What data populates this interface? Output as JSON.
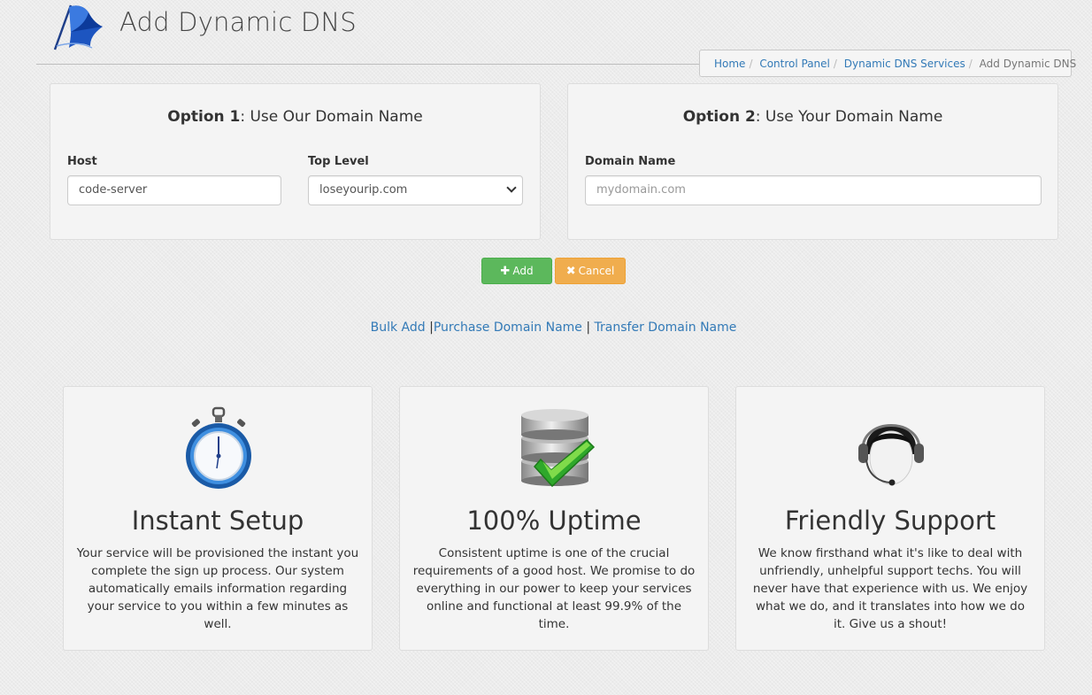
{
  "header": {
    "title": "Add Dynamic DNS",
    "logo_icon": "blue-flag-logo"
  },
  "breadcrumb": [
    {
      "label": "Home",
      "link": true
    },
    {
      "label": "Control Panel",
      "link": true
    },
    {
      "label": "Dynamic DNS Services",
      "link": true
    },
    {
      "label": "Add Dynamic DNS",
      "link": false
    }
  ],
  "option1": {
    "title_bold": "Option 1",
    "title_rest": ": Use Our Domain Name",
    "host_label": "Host",
    "host_value": "code-server",
    "toplevel_label": "Top Level",
    "toplevel_value": "loseyourip.com"
  },
  "option2": {
    "title_bold": "Option 2",
    "title_rest": ": Use Your Domain Name",
    "domain_label": "Domain Name",
    "domain_placeholder": "mydomain.com"
  },
  "actions": {
    "add_label": "Add",
    "add_icon": "plus-icon",
    "cancel_label": "Cancel",
    "cancel_icon": "x-icon",
    "add_color": "#5cb85c",
    "cancel_color": "#f0ad4e"
  },
  "links": {
    "bulk_add": "Bulk Add",
    "purchase": "Purchase Domain Name",
    "transfer": "Transfer Domain Name",
    "separator": "|"
  },
  "features": [
    {
      "icon": "stopwatch-icon",
      "title": "Instant Setup",
      "text": "Your service will be provisioned the instant you complete the sign up process. Our system automatically emails information regarding your service to you within a few minutes as well."
    },
    {
      "icon": "database-check-icon",
      "title": "100% Uptime",
      "text": "Consistent uptime is one of the crucial requirements of a good host. We promise to do everything in our power to keep your services online and functional at least 99.9% of the time."
    },
    {
      "icon": "support-headset-icon",
      "title": "Friendly Support",
      "text": "We know firsthand what it's like to deal with unfriendly, unhelpful support techs. You will never have that experience with us. We enjoy what we do, and it translates into how we do it. Give us a shout!"
    }
  ]
}
